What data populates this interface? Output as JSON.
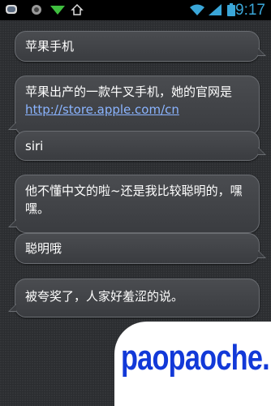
{
  "status_bar": {
    "time": "9:17",
    "icons": [
      "chat-app-icon",
      "record-icon",
      "signal-icon",
      "home-icon",
      "wifi-icon",
      "cell-signal-icon",
      "battery-icon"
    ]
  },
  "messages": [
    {
      "from": "user",
      "text": "苹果手机"
    },
    {
      "from": "bot",
      "text": "苹果出产的一款牛叉手机，她的官网是",
      "link": "http://store.apple.com/cn"
    },
    {
      "from": "user",
      "text": "siri"
    },
    {
      "from": "bot",
      "text": "他不懂中文的啦~还是我比较聪明的，嘿嘿。"
    },
    {
      "from": "user",
      "text": "聪明哦"
    },
    {
      "from": "bot",
      "text": "被夸奖了，人家好羞涩的说。"
    }
  ],
  "watermark": {
    "text": "paopaoche.net"
  },
  "colors": {
    "background": "#2b2d30",
    "bubble": "#3f4145",
    "bubble_border": "#6b6e73",
    "status_time": "#3aa6d8",
    "link": "#8ab4ff",
    "watermark_text": "#1239d8"
  }
}
